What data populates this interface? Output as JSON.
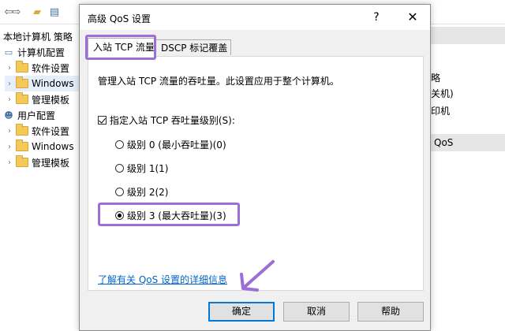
{
  "background": {
    "toolbar": {
      "icons": [
        "arrow-left-icon",
        "arrow-right-icon",
        "folder-up-icon",
        "properties-icon"
      ]
    },
    "tree": {
      "root_label": "本地计算机 策略",
      "computer_config": "计算机配置",
      "cc_software": "软件设置",
      "cc_windows": "Windows",
      "cc_admin": "管理模板",
      "user_config": "用户配置",
      "uc_software": "软件设置",
      "uc_windows": "Windows",
      "uc_admin": "管理模板"
    },
    "right_pane": {
      "line1": "略",
      "line2": "关机)",
      "line3": "印机",
      "line4": "QoS"
    }
  },
  "dialog": {
    "title": "高级 QoS 设置",
    "help_glyph": "?",
    "close_glyph": "✕",
    "tabs": [
      {
        "label": "入站 TCP 流量",
        "active": true
      },
      {
        "label": "DSCP 标记覆盖",
        "active": false
      }
    ],
    "description": "管理入站 TCP 流量的吞吐量。此设置应用于整个计算机。",
    "checkbox_label": "指定入站 TCP 吞吐量级别(S):",
    "checkbox_checked": true,
    "radios": [
      {
        "label": "级别 0 (最小吞吐量)(0)",
        "checked": false
      },
      {
        "label": "级别 1(1)",
        "checked": false
      },
      {
        "label": "级别 2(2)",
        "checked": false
      },
      {
        "label": "级别 3 (最大吞吐量)(3)",
        "checked": true
      }
    ],
    "link": "了解有关 QoS 设置的详细信息",
    "buttons": {
      "ok": "确定",
      "cancel": "取消",
      "help": "帮助"
    }
  },
  "colors": {
    "highlight": "#9b6ed8",
    "link": "#0066cc",
    "default_button_border": "#0078d7"
  }
}
